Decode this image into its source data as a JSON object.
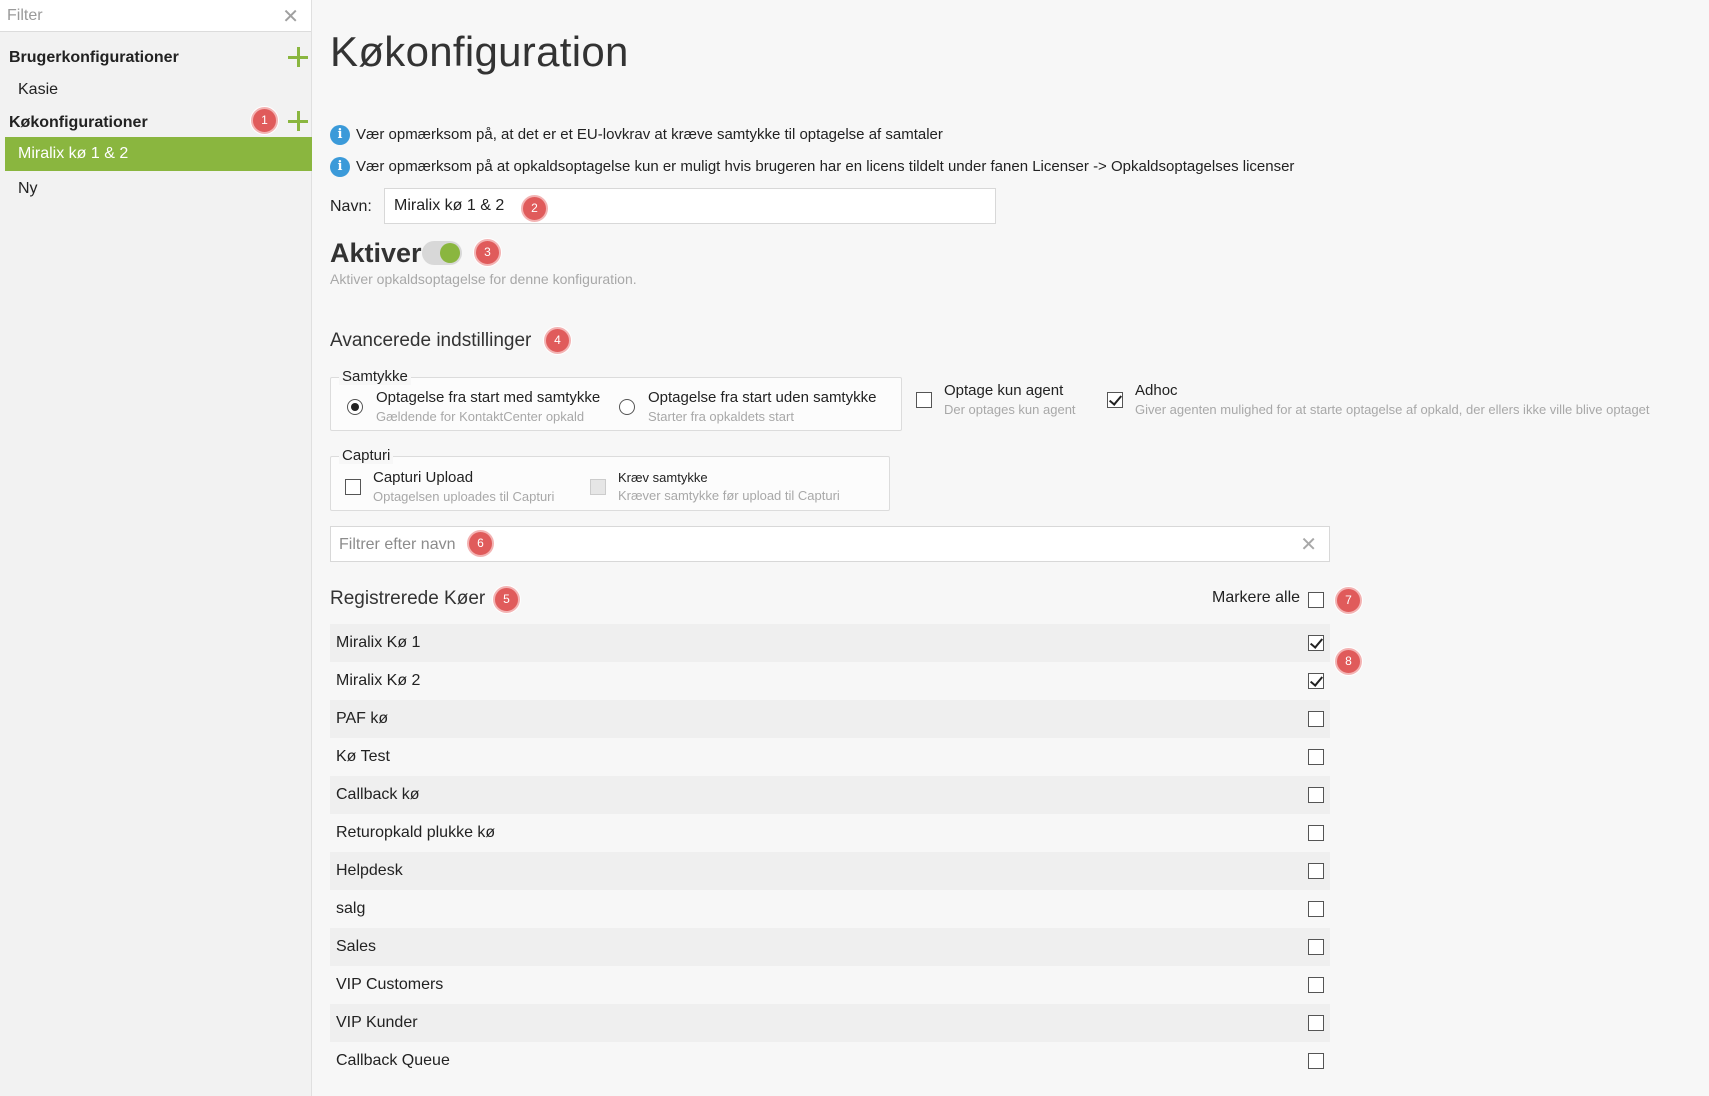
{
  "sidebar": {
    "filter_placeholder": "Filter",
    "user_configs_title": "Brugerkonfigurationer",
    "user_configs": [
      "Kasie"
    ],
    "queue_configs_title": "Køkonfigurationer",
    "queue_configs": [
      "Miralix kø 1 & 2",
      "Ny"
    ],
    "active_index": 0
  },
  "main": {
    "title": "Køkonfiguration",
    "info": [
      "Vær opmærksom på, at det er et EU-lovkrav at kræve samtykke til optagelse af samtaler",
      "Vær opmærksom på at opkaldsoptagelse kun er muligt hvis brugeren har en licens tildelt under fanen Licenser -> Opkaldsoptagelses licenser"
    ],
    "name_label": "Navn:",
    "name_value": "Miralix kø 1 & 2",
    "activate_label": "Aktiver",
    "activate_on": true,
    "activate_desc": "Aktiver opkaldsoptagelse for denne konfiguration.",
    "advanced_title": "Avancerede indstillinger",
    "consent": {
      "legend": "Samtykke",
      "option1_label": "Optagelse fra start med samtykke",
      "option1_sub": "Gældende for KontaktCenter opkald",
      "option2_label": "Optagelse fra start uden samtykke",
      "option2_sub": "Starter fra opkaldets start",
      "selected": 1
    },
    "agent_only": {
      "label": "Optage kun agent",
      "sub": "Der optages kun agent",
      "checked": false
    },
    "adhoc": {
      "label": "Adhoc",
      "sub": "Giver agenten mulighed for at starte optagelse af opkald, der ellers ikke ville blive optaget",
      "checked": true
    },
    "capturi": {
      "legend": "Capturi",
      "upload_label": "Capturi Upload",
      "upload_sub": "Optagelsen uploades til Capturi",
      "consent_label": "Kræv samtykke",
      "consent_sub": "Kræver samtykke før upload til Capturi"
    },
    "queue_filter_placeholder": "Filtrer efter navn",
    "registered_title": "Registrerede Køer",
    "select_all_label": "Markere alle",
    "queues": [
      {
        "name": "Miralix Kø 1",
        "checked": true
      },
      {
        "name": "Miralix Kø 2",
        "checked": true
      },
      {
        "name": "PAF kø",
        "checked": false
      },
      {
        "name": "Kø Test",
        "checked": false
      },
      {
        "name": "Callback kø",
        "checked": false
      },
      {
        "name": "Returopkald plukke kø",
        "checked": false
      },
      {
        "name": "Helpdesk",
        "checked": false
      },
      {
        "name": "salg",
        "checked": false
      },
      {
        "name": "Sales",
        "checked": false
      },
      {
        "name": "VIP Customers",
        "checked": false
      },
      {
        "name": "VIP Kunder",
        "checked": false
      },
      {
        "name": "Callback Queue",
        "checked": false
      }
    ]
  },
  "annotations": [
    "1",
    "2",
    "3",
    "4",
    "5",
    "6",
    "7",
    "8"
  ],
  "colors": {
    "accent": "#8ab63f",
    "info": "#3b9ad9",
    "badge": "#e05b5b"
  }
}
